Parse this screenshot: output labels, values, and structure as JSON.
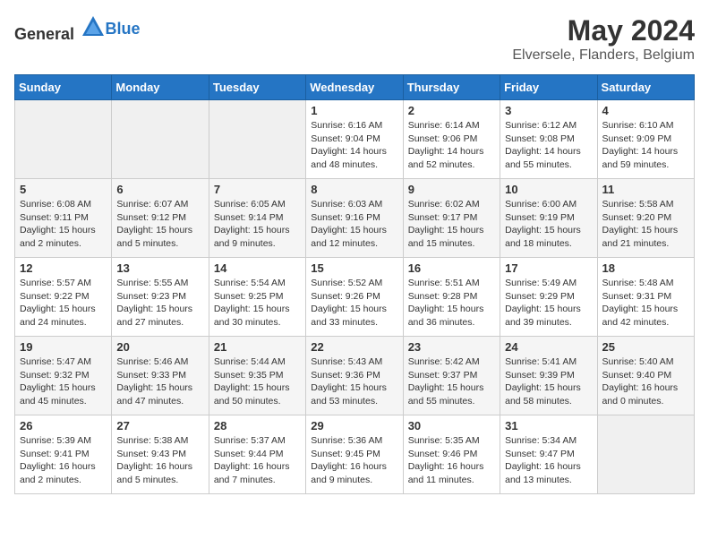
{
  "header": {
    "logo_general": "General",
    "logo_blue": "Blue",
    "month_year": "May 2024",
    "location": "Elversele, Flanders, Belgium"
  },
  "weekdays": [
    "Sunday",
    "Monday",
    "Tuesday",
    "Wednesday",
    "Thursday",
    "Friday",
    "Saturday"
  ],
  "weeks": [
    [
      {
        "day": "",
        "info": ""
      },
      {
        "day": "",
        "info": ""
      },
      {
        "day": "",
        "info": ""
      },
      {
        "day": "1",
        "info": "Sunrise: 6:16 AM\nSunset: 9:04 PM\nDaylight: 14 hours\nand 48 minutes."
      },
      {
        "day": "2",
        "info": "Sunrise: 6:14 AM\nSunset: 9:06 PM\nDaylight: 14 hours\nand 52 minutes."
      },
      {
        "day": "3",
        "info": "Sunrise: 6:12 AM\nSunset: 9:08 PM\nDaylight: 14 hours\nand 55 minutes."
      },
      {
        "day": "4",
        "info": "Sunrise: 6:10 AM\nSunset: 9:09 PM\nDaylight: 14 hours\nand 59 minutes."
      }
    ],
    [
      {
        "day": "5",
        "info": "Sunrise: 6:08 AM\nSunset: 9:11 PM\nDaylight: 15 hours\nand 2 minutes."
      },
      {
        "day": "6",
        "info": "Sunrise: 6:07 AM\nSunset: 9:12 PM\nDaylight: 15 hours\nand 5 minutes."
      },
      {
        "day": "7",
        "info": "Sunrise: 6:05 AM\nSunset: 9:14 PM\nDaylight: 15 hours\nand 9 minutes."
      },
      {
        "day": "8",
        "info": "Sunrise: 6:03 AM\nSunset: 9:16 PM\nDaylight: 15 hours\nand 12 minutes."
      },
      {
        "day": "9",
        "info": "Sunrise: 6:02 AM\nSunset: 9:17 PM\nDaylight: 15 hours\nand 15 minutes."
      },
      {
        "day": "10",
        "info": "Sunrise: 6:00 AM\nSunset: 9:19 PM\nDaylight: 15 hours\nand 18 minutes."
      },
      {
        "day": "11",
        "info": "Sunrise: 5:58 AM\nSunset: 9:20 PM\nDaylight: 15 hours\nand 21 minutes."
      }
    ],
    [
      {
        "day": "12",
        "info": "Sunrise: 5:57 AM\nSunset: 9:22 PM\nDaylight: 15 hours\nand 24 minutes."
      },
      {
        "day": "13",
        "info": "Sunrise: 5:55 AM\nSunset: 9:23 PM\nDaylight: 15 hours\nand 27 minutes."
      },
      {
        "day": "14",
        "info": "Sunrise: 5:54 AM\nSunset: 9:25 PM\nDaylight: 15 hours\nand 30 minutes."
      },
      {
        "day": "15",
        "info": "Sunrise: 5:52 AM\nSunset: 9:26 PM\nDaylight: 15 hours\nand 33 minutes."
      },
      {
        "day": "16",
        "info": "Sunrise: 5:51 AM\nSunset: 9:28 PM\nDaylight: 15 hours\nand 36 minutes."
      },
      {
        "day": "17",
        "info": "Sunrise: 5:49 AM\nSunset: 9:29 PM\nDaylight: 15 hours\nand 39 minutes."
      },
      {
        "day": "18",
        "info": "Sunrise: 5:48 AM\nSunset: 9:31 PM\nDaylight: 15 hours\nand 42 minutes."
      }
    ],
    [
      {
        "day": "19",
        "info": "Sunrise: 5:47 AM\nSunset: 9:32 PM\nDaylight: 15 hours\nand 45 minutes."
      },
      {
        "day": "20",
        "info": "Sunrise: 5:46 AM\nSunset: 9:33 PM\nDaylight: 15 hours\nand 47 minutes."
      },
      {
        "day": "21",
        "info": "Sunrise: 5:44 AM\nSunset: 9:35 PM\nDaylight: 15 hours\nand 50 minutes."
      },
      {
        "day": "22",
        "info": "Sunrise: 5:43 AM\nSunset: 9:36 PM\nDaylight: 15 hours\nand 53 minutes."
      },
      {
        "day": "23",
        "info": "Sunrise: 5:42 AM\nSunset: 9:37 PM\nDaylight: 15 hours\nand 55 minutes."
      },
      {
        "day": "24",
        "info": "Sunrise: 5:41 AM\nSunset: 9:39 PM\nDaylight: 15 hours\nand 58 minutes."
      },
      {
        "day": "25",
        "info": "Sunrise: 5:40 AM\nSunset: 9:40 PM\nDaylight: 16 hours\nand 0 minutes."
      }
    ],
    [
      {
        "day": "26",
        "info": "Sunrise: 5:39 AM\nSunset: 9:41 PM\nDaylight: 16 hours\nand 2 minutes."
      },
      {
        "day": "27",
        "info": "Sunrise: 5:38 AM\nSunset: 9:43 PM\nDaylight: 16 hours\nand 5 minutes."
      },
      {
        "day": "28",
        "info": "Sunrise: 5:37 AM\nSunset: 9:44 PM\nDaylight: 16 hours\nand 7 minutes."
      },
      {
        "day": "29",
        "info": "Sunrise: 5:36 AM\nSunset: 9:45 PM\nDaylight: 16 hours\nand 9 minutes."
      },
      {
        "day": "30",
        "info": "Sunrise: 5:35 AM\nSunset: 9:46 PM\nDaylight: 16 hours\nand 11 minutes."
      },
      {
        "day": "31",
        "info": "Sunrise: 5:34 AM\nSunset: 9:47 PM\nDaylight: 16 hours\nand 13 minutes."
      },
      {
        "day": "",
        "info": ""
      }
    ]
  ]
}
